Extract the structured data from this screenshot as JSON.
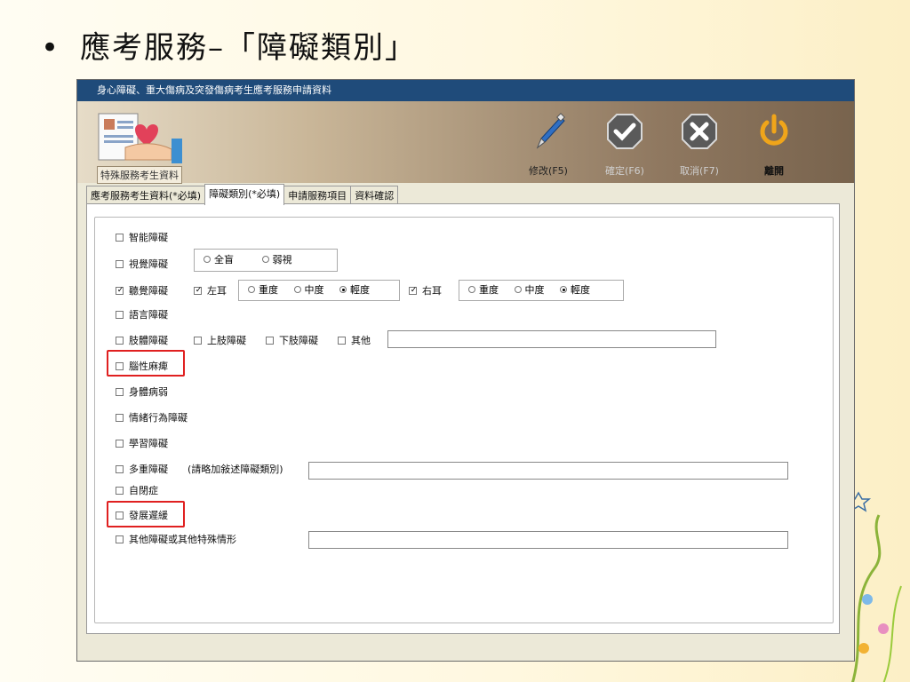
{
  "slide": {
    "bullet": "•",
    "title": "應考服務–「障礙類別」"
  },
  "window": {
    "title": "身心障礙、重大傷病及突發傷病考生應考服務申請資料"
  },
  "toolbar": {
    "logo_caption": "特殊服務考生資料",
    "edit_label": "修改(F5)",
    "confirm_label": "確定(F6)",
    "cancel_label": "取消(F7)",
    "exit_label": "離開"
  },
  "tabs": [
    {
      "label": "應考服務考生資料(*必填)"
    },
    {
      "label": "障礙類別(*必填)"
    },
    {
      "label": "申請服務項目"
    },
    {
      "label": "資料確認"
    }
  ],
  "form": {
    "intellectual": "智能障礙",
    "visual": "視覺障礙",
    "visual_opts": [
      "全盲",
      "弱視"
    ],
    "hearing": "聽覺障礙",
    "left_ear": "左耳",
    "right_ear": "右耳",
    "degree_opts": [
      "重度",
      "中度",
      "輕度"
    ],
    "speech": "語言障礙",
    "limb": "肢體障礙",
    "upper_limb": "上肢障礙",
    "lower_limb": "下肢障礙",
    "other": "其他",
    "cerebral": "腦性麻痺",
    "physical_weak": "身體病弱",
    "emotional": "情緒行為障礙",
    "learning": "學習障礙",
    "multiple": "多重障礙",
    "multiple_note": "(請略加敍述障礙類別)",
    "autism": "自閉症",
    "dev_delay": "發展遲緩",
    "other_special": "其他障礙或其他特殊情形"
  }
}
